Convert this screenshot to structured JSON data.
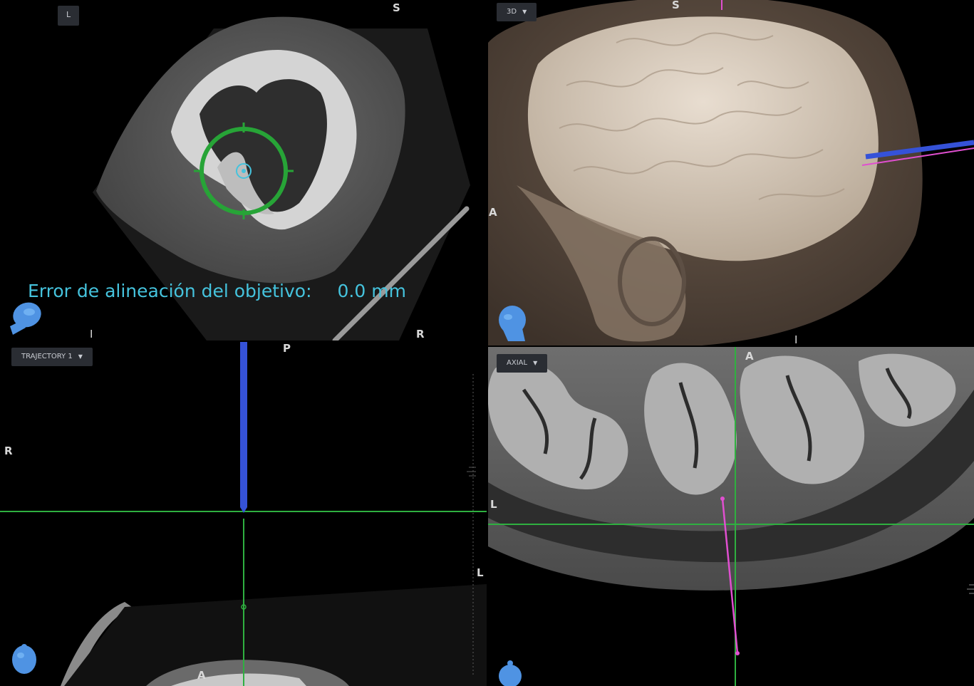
{
  "panes": {
    "coronal": {
      "view_menu_label": "L",
      "orient": {
        "top": "S",
        "bottom": "I",
        "right": "R"
      },
      "alignment_error": {
        "label": "Error de alineación del objetivo:",
        "value": "0.0 mm"
      }
    },
    "volume3d": {
      "view_menu_label": "3D",
      "orient": {
        "top": "S",
        "bottom": "I",
        "left": "A"
      }
    },
    "trajectory": {
      "view_menu_label": "TRAJECTORY 1",
      "orient": {
        "top": "P",
        "left": "R",
        "right": "L",
        "bottom": "A"
      }
    },
    "axial": {
      "view_menu_label": "AXIAL",
      "orient": {
        "top": "A",
        "left": "L"
      }
    }
  },
  "colors": {
    "target_ring": "#27a437",
    "crosshair": "#2fb040",
    "trajectory_blue": "#3552d8",
    "trajectory_pink": "#e04fd0",
    "readout_cyan": "#45c3dd",
    "head_icon": "#4f93e3"
  },
  "icons": [
    "head-orientation-icon",
    "chevron-down-icon"
  ]
}
